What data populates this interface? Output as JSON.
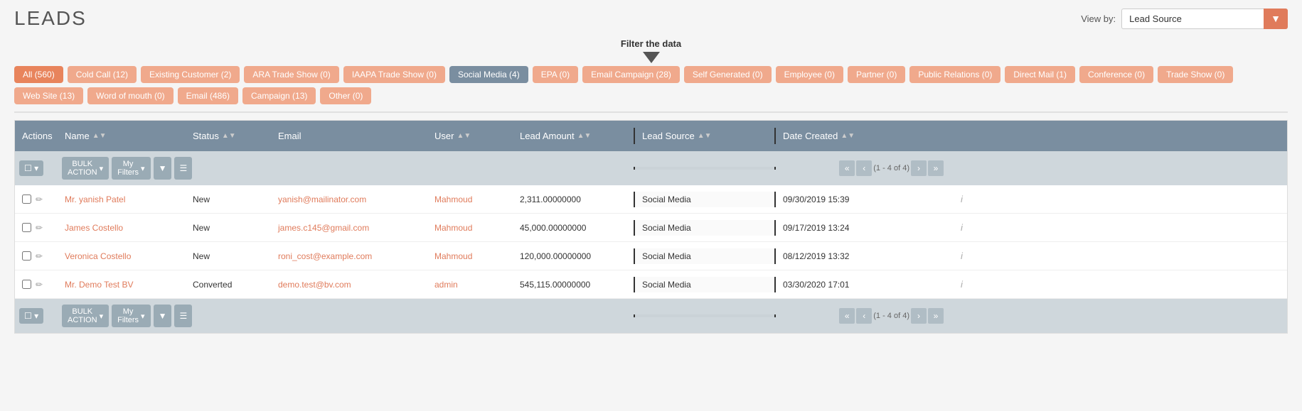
{
  "page": {
    "title": "LEADS",
    "filter_tooltip": "Filter the data",
    "view_by_label": "View by:",
    "view_by_value": "Lead Source"
  },
  "filter_tags": [
    {
      "label": "All (560)",
      "style": "orange",
      "active": false
    },
    {
      "label": "Cold Call (12)",
      "style": "light",
      "active": false
    },
    {
      "label": "Existing Customer (2)",
      "style": "light",
      "active": false
    },
    {
      "label": "ARA Trade Show (0)",
      "style": "light",
      "active": false
    },
    {
      "label": "IAAPA Trade Show (0)",
      "style": "light",
      "active": false
    },
    {
      "label": "Social Media (4)",
      "style": "active",
      "active": true
    },
    {
      "label": "EPA (0)",
      "style": "light",
      "active": false
    },
    {
      "label": "Email Campaign (28)",
      "style": "light",
      "active": false
    },
    {
      "label": "Self Generated (0)",
      "style": "light",
      "active": false
    },
    {
      "label": "Employee (0)",
      "style": "light",
      "active": false
    },
    {
      "label": "Partner (0)",
      "style": "light",
      "active": false
    },
    {
      "label": "Public Relations (0)",
      "style": "light",
      "active": false
    },
    {
      "label": "Direct Mail (1)",
      "style": "light",
      "active": false
    },
    {
      "label": "Conference (0)",
      "style": "light",
      "active": false
    },
    {
      "label": "Trade Show (0)",
      "style": "light",
      "active": false
    },
    {
      "label": "Web Site (13)",
      "style": "light",
      "active": false
    },
    {
      "label": "Word of mouth (0)",
      "style": "light",
      "active": false
    },
    {
      "label": "Email (486)",
      "style": "light",
      "active": false
    },
    {
      "label": "Campaign (13)",
      "style": "light",
      "active": false
    },
    {
      "label": "Other (0)",
      "style": "light",
      "active": false
    }
  ],
  "table": {
    "columns": [
      {
        "label": "Actions",
        "sortable": false
      },
      {
        "label": "Name",
        "sortable": true
      },
      {
        "label": "Status",
        "sortable": true
      },
      {
        "label": "Email",
        "sortable": false
      },
      {
        "label": "User",
        "sortable": true
      },
      {
        "label": "Lead Amount",
        "sortable": true
      },
      {
        "label": "Lead Source",
        "sortable": true,
        "highlighted": true
      },
      {
        "label": "Date Created",
        "sortable": true
      },
      {
        "label": "",
        "sortable": false
      }
    ],
    "toolbar": {
      "bulk_action": "BULK ACTION",
      "my_filters": "My Filters",
      "pagination": "(1 - 4 of 4)"
    },
    "rows": [
      {
        "name": "Mr. yanish Patel",
        "status": "New",
        "email": "yanish@mailinator.com",
        "user": "Mahmoud",
        "lead_amount": "2,311.00000000",
        "lead_source": "Social Media",
        "date_created": "09/30/2019 15:39"
      },
      {
        "name": "James Costello",
        "status": "New",
        "email": "james.c145@gmail.com",
        "user": "Mahmoud",
        "lead_amount": "45,000.00000000",
        "lead_source": "Social Media",
        "date_created": "09/17/2019 13:24"
      },
      {
        "name": "Veronica Costello",
        "status": "New",
        "email": "roni_cost@example.com",
        "user": "Mahmoud",
        "lead_amount": "120,000.00000000",
        "lead_source": "Social Media",
        "date_created": "08/12/2019 13:32"
      },
      {
        "name": "Mr. Demo Test BV",
        "status": "Converted",
        "email": "demo.test@bv.com",
        "user": "admin",
        "lead_amount": "545,115.00000000",
        "lead_source": "Social Media",
        "date_created": "03/30/2020 17:01"
      }
    ]
  }
}
